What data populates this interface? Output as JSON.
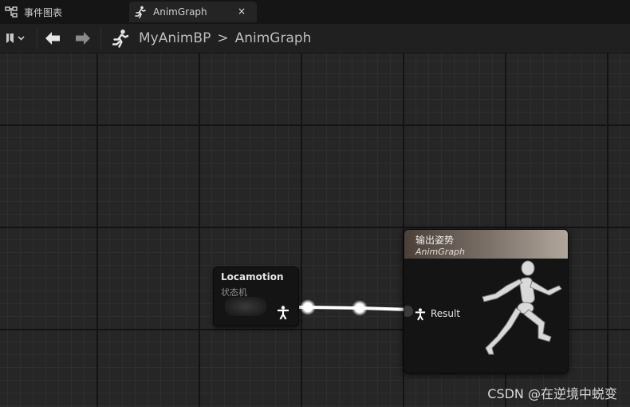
{
  "tabs": [
    {
      "label": "事件图表",
      "icon": "event-graph-icon"
    },
    {
      "label": "AnimGraph",
      "icon": "running-man-icon",
      "close": "×"
    }
  ],
  "toolbar": {
    "breadcrumb": {
      "blueprint": "MyAnimBP",
      "separator": ">",
      "graph": "AnimGraph"
    }
  },
  "nodes": {
    "state_machine": {
      "title": "Locamotion",
      "subtitle": "状态机"
    },
    "output_pose": {
      "title": "输出姿势",
      "subtitle": "AnimGraph",
      "pin_label": "Result"
    }
  },
  "watermark": "CSDN @在逆境中蜕变"
}
